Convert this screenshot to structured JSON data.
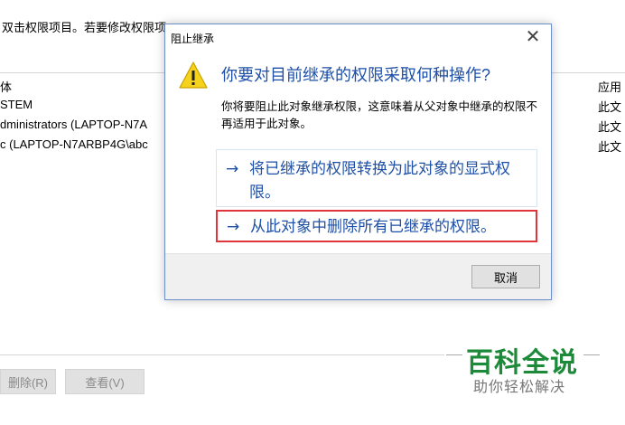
{
  "background": {
    "instruction": "双击权限项目。若要修改权限项目，请选择该项目并单击\"编辑\"(如果可用)。",
    "col_principal": "体",
    "col_applies": "应用",
    "rows": [
      {
        "principal": "STEM",
        "applies": "此文"
      },
      {
        "principal": "dministrators (LAPTOP-N7A",
        "applies": "此文"
      },
      {
        "principal": "c (LAPTOP-N7ARBP4G\\abc",
        "applies": "此文"
      }
    ],
    "delete_label": "删除(R)",
    "view_label": "查看(V)"
  },
  "dialog": {
    "title": "阻止继承",
    "heading": "你要对目前继承的权限采取何种操作?",
    "description": "你将要阻止此对象继承权限，这意味着从父对象中继承的权限不再适用于此对象。",
    "option1": "将已继承的权限转换为此对象的显式权限。",
    "option2": "从此对象中删除所有已继承的权限。",
    "cancel": "取消",
    "close_glyph": "✕",
    "arrow_glyph": "→"
  },
  "watermark": {
    "title": "百科全说",
    "subtitle": "助你轻松解决"
  },
  "colors": {
    "link": "#1e50a8",
    "highlight_border": "#e0353b",
    "watermark_green": "#1d8a3a"
  }
}
